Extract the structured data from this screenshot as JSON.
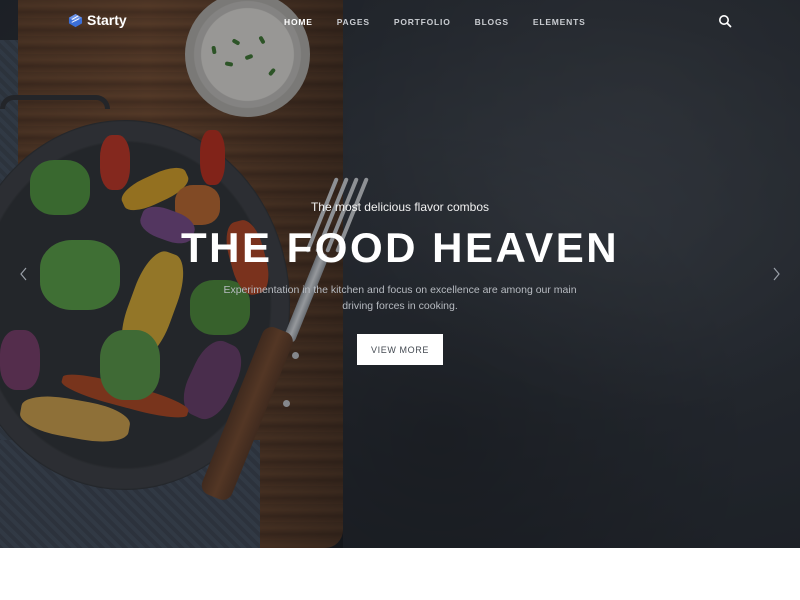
{
  "brand": {
    "name": "Starty",
    "logo_icon": "cube-logo-icon",
    "accent": "#3b6fd8"
  },
  "nav": {
    "items": [
      {
        "label": "HOME",
        "active": true
      },
      {
        "label": "PAGES",
        "active": false
      },
      {
        "label": "PORTFOLIO",
        "active": false
      },
      {
        "label": "BLOGS",
        "active": false
      },
      {
        "label": "ELEMENTS",
        "active": false
      }
    ],
    "search_icon": "search-icon"
  },
  "hero": {
    "subtitle": "The most delicious flavor combos",
    "title": "THE FOOD HEAVEN",
    "description": "Experimentation in the kitchen and focus on excellence are among our main driving forces in cooking.",
    "cta_label": "VIEW MORE",
    "prev_icon": "chevron-left-icon",
    "next_icon": "chevron-right-icon"
  }
}
